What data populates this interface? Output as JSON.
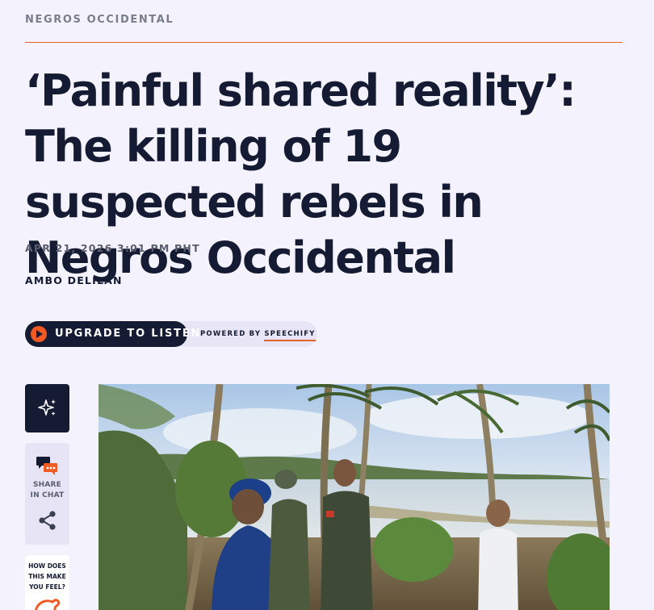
{
  "article": {
    "kicker": "NEGROS OCCIDENTAL",
    "headline": "‘Painful shared reality’: The killing of 19 suspected rebels in Negros Occidental",
    "dateline": "APR 21, 2026 3:01 PM PHT",
    "author": "AMBO DELILAN"
  },
  "audio": {
    "listen_label": "UPGRADE TO LISTEN",
    "powered_prefix": "POWERED BY",
    "powered_brand": "SPEECHIFY"
  },
  "sidebar": {
    "share_chat_line1": "SHARE",
    "share_chat_line2": "IN CHAT",
    "feel_line1": "HOW DOES",
    "feel_line2": "THIS MAKE",
    "feel_line3": "YOU FEEL?"
  },
  "icons": {
    "ai": "sparkle-icon",
    "chat": "chat-bubble-icon",
    "share": "share-icon",
    "feel": "emoji-reaction-icon",
    "play": "play-icon"
  },
  "colors": {
    "accent": "#e2632d",
    "play_orange": "#f15a22",
    "navy": "#141b32",
    "background": "#f4f3fd"
  }
}
